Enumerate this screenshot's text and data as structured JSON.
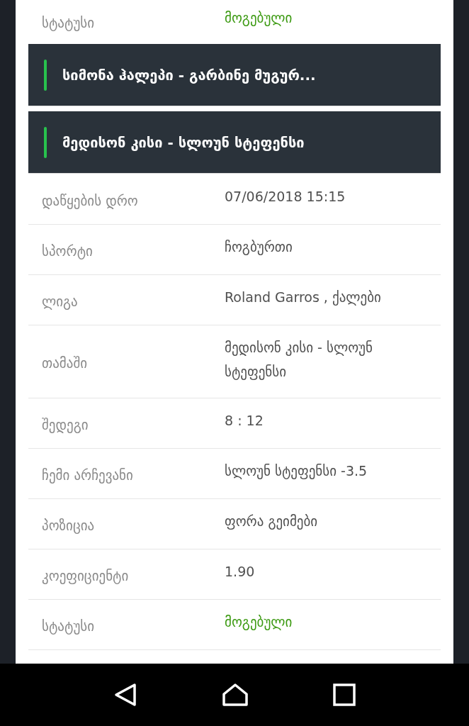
{
  "previous_detail": {
    "label": "სტატუსი",
    "value": "მოგებული",
    "kind": "status"
  },
  "matches": [
    {
      "title": "სიმონა ჰალეპი - გარბინე მუგურ..."
    },
    {
      "title": "მედისონ კისი - სლოუნ სტეფენსი"
    }
  ],
  "details": [
    {
      "label": "დაწყების დრო",
      "value": "07/06/2018 15:15",
      "kind": "text"
    },
    {
      "label": "სპორტი",
      "value": "ჩოგბურთი",
      "kind": "text"
    },
    {
      "label": "ლიგა",
      "value": "Roland Garros , ქალები",
      "kind": "text"
    },
    {
      "label": "თამაში",
      "value": "მედისონ კისი - სლოუნ სტეფენსი",
      "kind": "text"
    },
    {
      "label": "შედეგი",
      "value": "8 : 12",
      "kind": "text"
    },
    {
      "label": "ჩემი არჩევანი",
      "value": "სლოუნ სტეფენსი -3.5",
      "kind": "text"
    },
    {
      "label": "პოზიცია",
      "value": "ფორა გეიმები",
      "kind": "text"
    },
    {
      "label": "კოეფიციენტი",
      "value": "1.90",
      "kind": "text"
    },
    {
      "label": "სტატუსი",
      "value": "მოგებული",
      "kind": "status"
    }
  ]
}
